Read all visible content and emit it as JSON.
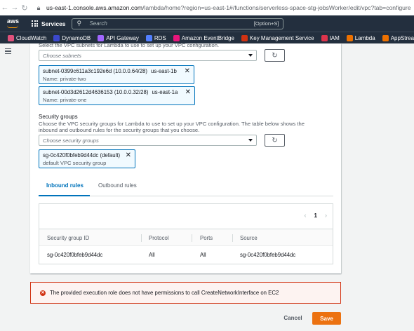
{
  "browser": {
    "host": "us-east-1.console.aws.amazon.com",
    "path": "/lambda/home?region=us-east-1#/functions/serverless-space-stg-jobsWorker/edit/vpc?tab=configure"
  },
  "topnav": {
    "logo": "aws",
    "services": "Services",
    "search_placeholder": "Search",
    "search_shortcut": "[Option+S]"
  },
  "bookmarks": [
    {
      "label": "CloudWatch",
      "color": "#e0517b"
    },
    {
      "label": "DynamoDB",
      "color": "#3b48cc"
    },
    {
      "label": "API Gateway",
      "color": "#a166ff"
    },
    {
      "label": "RDS",
      "color": "#527fff"
    },
    {
      "label": "Amazon EventBridge",
      "color": "#e7157b"
    },
    {
      "label": "Key Management Service",
      "color": "#d13212"
    },
    {
      "label": "IAM",
      "color": "#dd344c"
    },
    {
      "label": "Lambda",
      "color": "#ed7100"
    },
    {
      "label": "AppStream 2.0",
      "color": "#ed7100"
    }
  ],
  "subnets": {
    "description": "Select the VPC subnets for Lambda to use to set up your VPC configuration.",
    "placeholder": "Choose subnets",
    "tokens": [
      {
        "id": "subnet-0399c611a3c192e6d (10.0.0.64/28)",
        "zone": "us-east-1b",
        "name": "Name: private-two"
      },
      {
        "id": "subnet-00d3d2612d4636153 (10.0.0.32/28)",
        "zone": "us-east-1a",
        "name": "Name: private-one"
      }
    ]
  },
  "security_groups": {
    "label": "Security groups",
    "description_line1": "Choose the VPC security groups for Lambda to use to set up your VPC configuration. The table below shows the",
    "description_line2": "inbound and outbound rules for the security groups that you choose.",
    "placeholder": "Choose security groups",
    "token": {
      "id": "sg-0c420f0bfeb9d44dc (default)",
      "name": "default VPC security group"
    }
  },
  "tabs": [
    {
      "label": "Inbound rules",
      "active": true
    },
    {
      "label": "Outbound rules",
      "active": false
    }
  ],
  "pagination": {
    "page": "1"
  },
  "table": {
    "columns": [
      "Security group ID",
      "Protocol",
      "Ports",
      "Source"
    ],
    "rows": [
      [
        "sg-0c420f0bfeb9d44dc",
        "All",
        "All",
        "sg-0c420f0bfeb9d44dc"
      ]
    ]
  },
  "error": {
    "message": "The provided execution role does not have permissions to call CreateNetworkInterface on EC2"
  },
  "actions": {
    "cancel": "Cancel",
    "save": "Save"
  }
}
